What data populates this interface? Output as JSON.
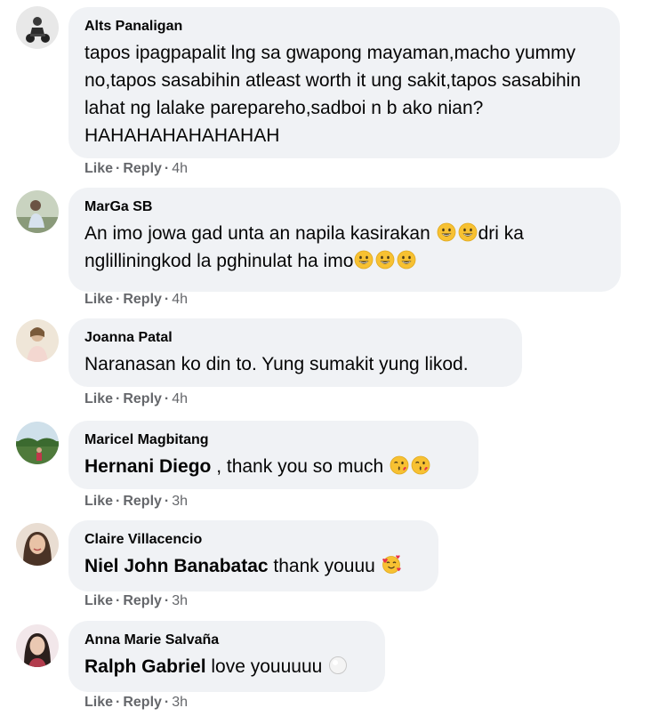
{
  "comments": [
    {
      "author": "Alts Panaligan",
      "text": "tapos ipagpapalit lng sa gwapong mayaman,macho yummy no,tapos sasabihin atleast worth it ung sakit,tapos sasabihin lahat ng lalake parepareho,sadboi n b ako nian?HAHAHAHAHAHAHAH",
      "like": "Like",
      "reply": "Reply",
      "time": "4h",
      "avatar_icon": "avatar-photo-rider"
    },
    {
      "author": "MarGa SB",
      "text_a": "An imo jowa gad unta an napila kasirakan ",
      "text_b": "dri ka nglilliningkod la pghinulat ha imo",
      "like": "Like",
      "reply": "Reply",
      "time": "4h",
      "emoji": "grinning-face-emoji",
      "avatar_icon": "avatar-photo-outdoor"
    },
    {
      "author": "Joanna Patal",
      "text": "Naranasan ko din to. Yung sumakit yung likod.",
      "like": "Like",
      "reply": "Reply",
      "time": "4h",
      "avatar_icon": "avatar-photo-person"
    },
    {
      "author": "Maricel Magbitang",
      "mention": "Hernani Diego",
      "text": " , thank you so much ",
      "like": "Like",
      "reply": "Reply",
      "time": "3h",
      "emoji": "face-blowing-kiss-emoji",
      "avatar_icon": "avatar-photo-landscape"
    },
    {
      "author": "Claire Villacencio",
      "mention": "Niel John Banabatac",
      "text": " thank youuu ",
      "like": "Like",
      "reply": "Reply",
      "time": "3h",
      "emoji": "smiling-face-with-hearts-emoji",
      "avatar_icon": "avatar-photo-portrait"
    },
    {
      "author": "Anna Marie Salvaña",
      "mention": "Ralph Gabriel",
      "text": " love youuuuu ",
      "like": "Like",
      "reply": "Reply",
      "time": "3h",
      "emoji": "white-circle-emoji",
      "avatar_icon": "avatar-photo-portrait-2"
    }
  ],
  "colors": {
    "bubble": "#f0f2f5",
    "text": "#050505",
    "secondary": "#65676b",
    "emoji_yellow": "#f7c132"
  }
}
